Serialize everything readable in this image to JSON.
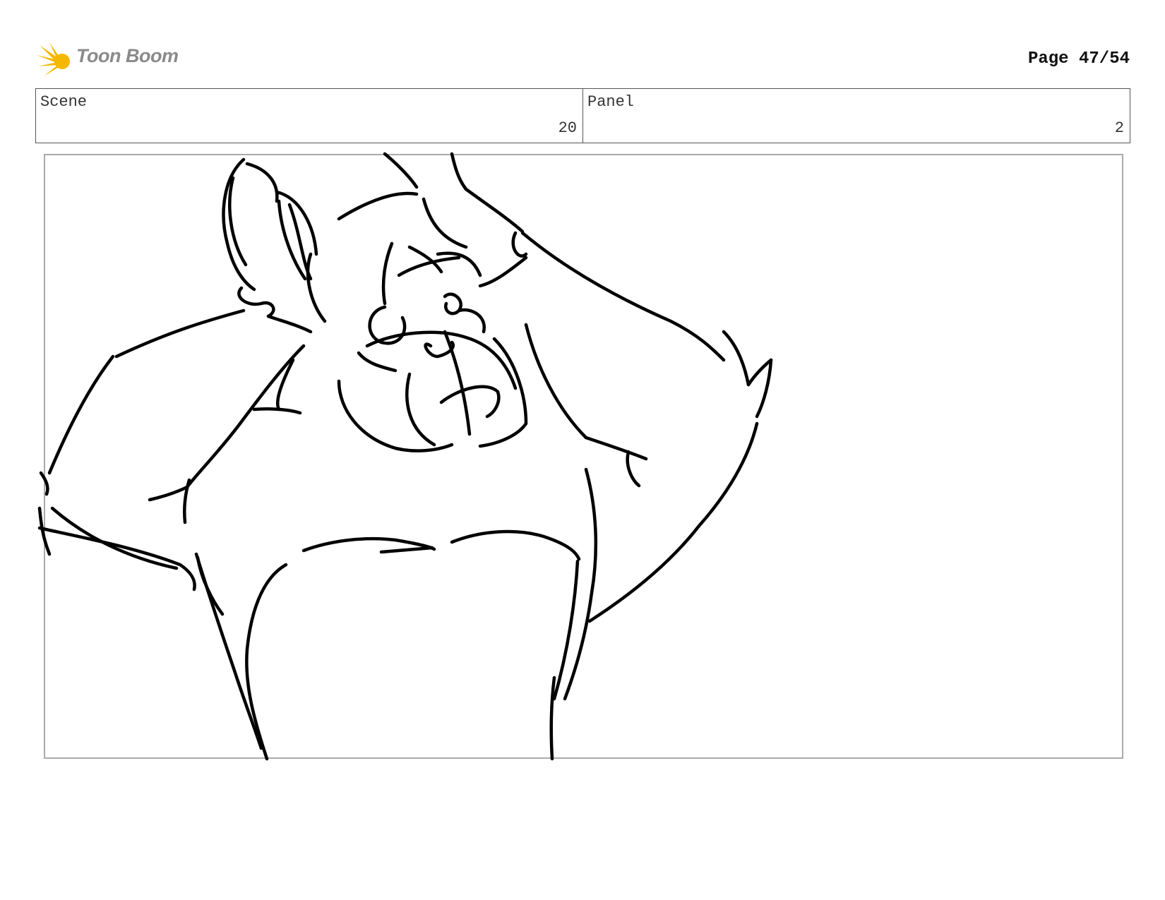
{
  "header": {
    "logo_text": "Toon Boom",
    "page_label": "Page 47/54"
  },
  "info": {
    "scene_label": "Scene",
    "scene_value": "20",
    "panel_label": "Panel",
    "panel_value": "2"
  },
  "colors": {
    "logo_yellow": "#f5b800",
    "logo_gray": "#8a8a8a",
    "frame_border": "#aaaaaa"
  }
}
